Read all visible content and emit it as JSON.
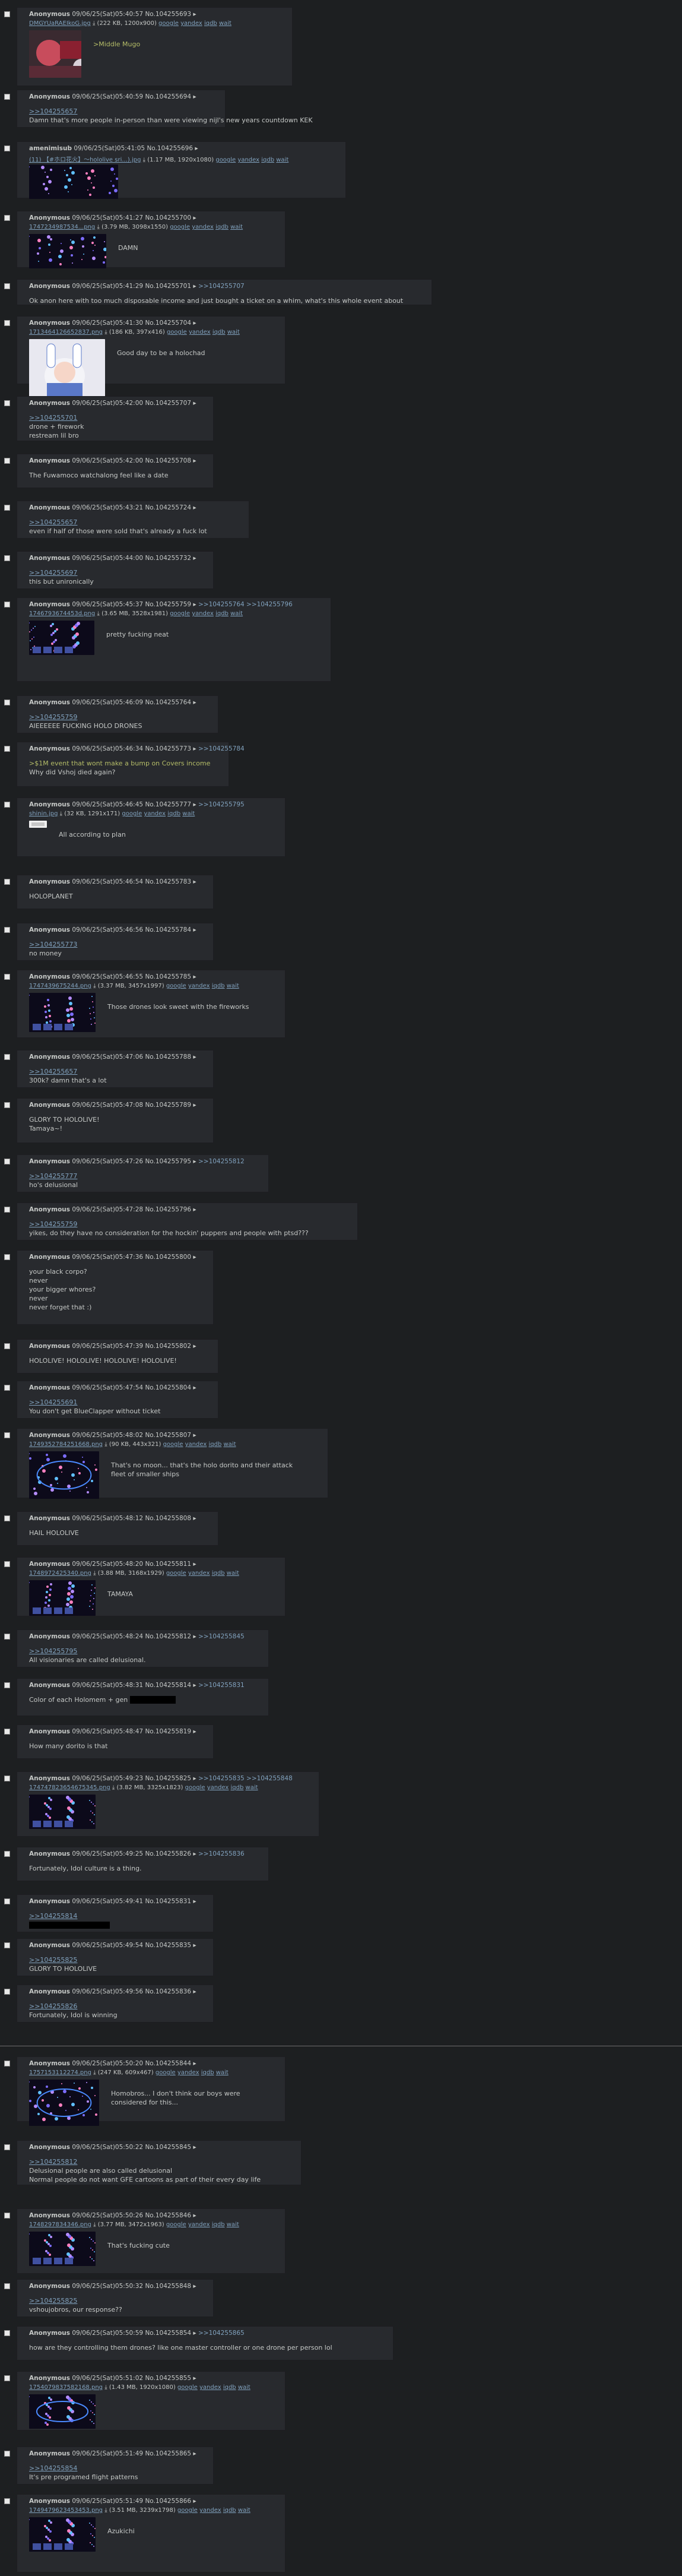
{
  "common": {
    "anon": "Anonymous",
    "arrow": "▸",
    "google": "google",
    "yandex": "yandex",
    "iqdb": "iqdb",
    "wait": "wait",
    "dl": "⤓"
  },
  "posts": [
    {
      "date": "09/06/25(Sat)05:40:57",
      "no": "No.104255693",
      "file": "DMGYUaRAEIkoG.jpg",
      "meta": "(222 KB, 1200x900)",
      "q": "",
      "body": [
        {
          "t": ">Middle Mugo",
          "c": "gt"
        }
      ]
    },
    {
      "date": "09/06/25(Sat)05:40:59",
      "no": "No.104255694",
      "q": "",
      "body": [
        {
          "t": ">>104255657",
          "c": "ql"
        },
        {
          "t": "Damn that's more people in-person than were viewing nijl's new years countdown KEK"
        }
      ]
    },
    {
      "name": "amenimisub",
      "date": "09/06/25(Sat)05:41:05",
      "no": "No.104255696",
      "file": "(11) 【#ホロ花火】～hololive sri...).jpg",
      "meta": "(1.17 MB, 1920x1080)",
      "q": "",
      "body": []
    },
    {
      "date": "09/06/25(Sat)05:41:27",
      "no": "No.104255700",
      "file": "1747234987534...png",
      "meta": "(3.79 MB, 3098x1550)",
      "q": "",
      "body": [
        {
          "t": "DAMN"
        }
      ]
    },
    {
      "date": "09/06/25(Sat)05:41:29",
      "no": "No.104255701",
      "q": ">>104255707",
      "body": [
        {
          "t": "Ok anon here with too much disposable income and just bought a ticket on a whim, what's this whole event about"
        }
      ]
    },
    {
      "date": "09/06/25(Sat)05:41:30",
      "no": "No.104255704",
      "file": "1713464126652837.png",
      "meta": "(186 KB, 397x416)",
      "q": "",
      "body": [
        {
          "t": "Good day to be a holochad"
        }
      ]
    },
    {
      "date": "09/06/25(Sat)05:42:00",
      "no": "No.104255707",
      "q": "",
      "body": [
        {
          "t": ">>104255701",
          "c": "ql"
        },
        {
          "t": "drone + firework"
        },
        {
          "t": "restream lil bro"
        }
      ]
    },
    {
      "date": "09/06/25(Sat)05:42:00",
      "no": "No.104255708",
      "q": "",
      "body": [
        {
          "t": "The Fuwamoco watchalong feel like a date"
        }
      ]
    },
    {
      "date": "09/06/25(Sat)05:43:21",
      "no": "No.104255724",
      "q": "",
      "body": [
        {
          "t": ">>104255657",
          "c": "ql"
        },
        {
          "t": "even if half of those were sold that's already a fuck lot"
        }
      ]
    },
    {
      "date": "09/06/25(Sat)05:44:00",
      "no": "No.104255732",
      "q": "",
      "body": [
        {
          "t": ">>104255697",
          "c": "ql"
        },
        {
          "t": "this but unironically"
        }
      ]
    },
    {
      "date": "09/06/25(Sat)05:45:37",
      "no": "No.104255759",
      "q": ">>104255764 >>104255796",
      "file": "1746793674453d.png",
      "meta": "(3.65 MB, 3528x1981)",
      "body": [
        {
          "t": "pretty fucking neat"
        }
      ]
    },
    {
      "date": "09/06/25(Sat)05:46:09",
      "no": "No.104255764",
      "q": "",
      "body": [
        {
          "t": ">>104255759",
          "c": "ql"
        },
        {
          "t": "AIEEEEEE FUCKING HOLO DRONES"
        }
      ]
    },
    {
      "date": "09/06/25(Sat)05:46:34",
      "no": "No.104255773",
      "q": ">>104255784",
      "body": [
        {
          "t": ">$1M event that wont make a bump on Covers income",
          "c": "gt"
        },
        {
          "t": "Why did Vshoj died again?"
        }
      ]
    },
    {
      "date": "09/06/25(Sat)05:46:45",
      "no": "No.104255777",
      "q": ">>104255795",
      "file": "shinin.jpg",
      "meta": "(32 KB, 1291x171)",
      "body": [
        {
          "t": "All according to plan"
        }
      ]
    },
    {
      "date": "09/06/25(Sat)05:46:54",
      "no": "No.104255783",
      "q": "",
      "body": [
        {
          "t": "HOLOPLANET"
        }
      ]
    },
    {
      "date": "09/06/25(Sat)05:46:56",
      "no": "No.104255784",
      "q": "",
      "body": [
        {
          "t": ">>104255773",
          "c": "ql"
        },
        {
          "t": "no money"
        }
      ]
    },
    {
      "date": "09/06/25(Sat)05:46:55",
      "no": "No.104255785",
      "file": "1747439675244.png",
      "meta": "(3.37 MB, 3457x1997)",
      "q": "",
      "body": [
        {
          "t": "Those drones look sweet with the fireworks"
        }
      ]
    },
    {
      "date": "09/06/25(Sat)05:47:06",
      "no": "No.104255788",
      "q": "",
      "body": [
        {
          "t": ">>104255657",
          "c": "ql"
        },
        {
          "t": "300k? damn that's a lot"
        }
      ]
    },
    {
      "date": "09/06/25(Sat)05:47:08",
      "no": "No.104255789",
      "q": "",
      "body": [
        {
          "t": "GLORY TO HOLOLIVE!"
        },
        {
          "t": "Tamaya~!"
        }
      ]
    },
    {
      "date": "09/06/25(Sat)05:47:26",
      "no": "No.104255795",
      "q": ">>104255812",
      "body": [
        {
          "t": ">>104255777",
          "c": "ql"
        },
        {
          "t": "ho's delusional"
        }
      ]
    },
    {
      "date": "09/06/25(Sat)05:47:28",
      "no": "No.104255796",
      "q": "",
      "body": [
        {
          "t": ">>104255759",
          "c": "ql"
        },
        {
          "t": "yikes, do they have no consideration for the hockin' puppers and people with ptsd???"
        }
      ]
    },
    {
      "date": "09/06/25(Sat)05:47:36",
      "no": "No.104255800",
      "q": "",
      "body": [
        {
          "t": "your black corpo?"
        },
        {
          "t": "never"
        },
        {
          "t": "your bigger whores?"
        },
        {
          "t": "never"
        },
        {
          "t": "never forget that :)"
        }
      ]
    },
    {
      "date": "09/06/25(Sat)05:47:39",
      "no": "No.104255802",
      "q": "",
      "body": [
        {
          "t": "HOLOLIVE! HOLOLIVE! HOLOLIVE! HOLOLIVE!"
        }
      ]
    },
    {
      "date": "09/06/25(Sat)05:47:54",
      "no": "No.104255804",
      "q": "",
      "body": [
        {
          "t": ">>104255691",
          "c": "ql"
        },
        {
          "t": "You don't get BlueClapper without ticket"
        }
      ]
    },
    {
      "date": "09/06/25(Sat)05:48:02",
      "no": "No.104255807",
      "file": "1749352784251668.png",
      "meta": "(90 KB, 443x321)",
      "q": "",
      "body": [
        {
          "t": "That's no moon... that's the holo dorito and their attack"
        },
        {
          "t": "fleet of smaller ships"
        }
      ]
    },
    {
      "date": "09/06/25(Sat)05:48:12",
      "no": "No.104255808",
      "q": "",
      "body": [
        {
          "t": "HAIL HOLOLIVE"
        }
      ]
    },
    {
      "date": "09/06/25(Sat)05:48:20",
      "no": "No.104255811",
      "file": "1748972425340.png",
      "meta": "(3.88 MB, 3168x1929)",
      "q": "",
      "body": [
        {
          "t": "TAMAYA"
        }
      ]
    },
    {
      "date": "09/06/25(Sat)05:48:24",
      "no": "No.104255812",
      "q": ">>104255845",
      "body": [
        {
          "t": ">>104255795",
          "c": "ql"
        },
        {
          "t": "All visionaries are called delusional."
        }
      ]
    },
    {
      "date": "09/06/25(Sat)05:48:31",
      "no": "No.104255814",
      "q": ">>104255831",
      "body": [
        {
          "t": "Color of each Holomem + gen"
        }
      ]
    },
    {
      "date": "09/06/25(Sat)05:48:47",
      "no": "No.104255819",
      "q": "",
      "body": [
        {
          "t": "How many dorito is that"
        }
      ]
    },
    {
      "date": "09/06/25(Sat)05:49:23",
      "no": "No.104255825",
      "q": ">>104255835 >>104255848",
      "file": "174747823654675345.png",
      "meta": "(3.82 MB, 3325x1823)",
      "body": []
    },
    {
      "date": "09/06/25(Sat)05:49:25",
      "no": "No.104255826",
      "q": ">>104255836",
      "body": [
        {
          "t": "Fortunately, Idol culture is a thing."
        }
      ]
    },
    {
      "date": "09/06/25(Sat)05:49:41",
      "no": "No.104255831",
      "q": "",
      "body": [
        {
          "t": ">>104255814",
          "c": "ql"
        }
      ]
    },
    {
      "date": "09/06/25(Sat)05:49:54",
      "no": "No.104255835",
      "q": "",
      "body": [
        {
          "t": ">>104255825",
          "c": "ql"
        },
        {
          "t": "GLORY TO HOLOLIVE"
        }
      ]
    },
    {
      "date": "09/06/25(Sat)05:49:56",
      "no": "No.104255836",
      "q": "",
      "body": [
        {
          "t": ">>104255826",
          "c": "ql"
        },
        {
          "t": "Fortunately, Idol is winning"
        }
      ]
    },
    {
      "date": "09/06/25(Sat)05:50:20",
      "no": "No.104255844",
      "file": "1757153112274.png",
      "meta": "(247 KB, 609x467)",
      "q": "",
      "body": [
        {
          "t": "Homobros... I don't think our boys were"
        },
        {
          "t": "considered for this..."
        }
      ]
    },
    {
      "date": "09/06/25(Sat)05:50:22",
      "no": "No.104255845",
      "q": "",
      "body": [
        {
          "t": ">>104255812",
          "c": "ql"
        },
        {
          "t": "Delusional people are also called delusional"
        },
        {
          "t": "Normal people do not want GFE cartoons as part of their every day life"
        }
      ]
    },
    {
      "date": "09/06/25(Sat)05:50:26",
      "no": "No.104255846",
      "file": "1748297834346.png",
      "meta": "(3.77 MB, 3472x1963)",
      "q": "",
      "body": [
        {
          "t": "That's fucking cute"
        }
      ]
    },
    {
      "date": "09/06/25(Sat)05:50:32",
      "no": "No.104255848",
      "q": "",
      "body": [
        {
          "t": ">>104255825",
          "c": "ql"
        },
        {
          "t": "vshoujobros, our response??"
        }
      ]
    },
    {
      "date": "09/06/25(Sat)05:50:59",
      "no": "No.104255854",
      "q": ">>104255865",
      "body": [
        {
          "t": "how are they controlling them drones? like one master controller or one drone per person lol"
        }
      ]
    },
    {
      "date": "09/06/25(Sat)05:51:02",
      "no": "No.104255855",
      "file": "1754079837582168.png",
      "meta": "(1.43 MB, 1920x1080)",
      "q": "",
      "body": []
    },
    {
      "date": "09/06/25(Sat)05:51:49",
      "no": "No.104255865",
      "q": "",
      "body": [
        {
          "t": ">>104255854",
          "c": "ql"
        },
        {
          "t": "It's pre programed flight patterns"
        }
      ]
    },
    {
      "date": "09/06/25(Sat)05:51:49",
      "no": "No.104255866",
      "file": "1749479623453453.png",
      "meta": "(3.51 MB, 3239x1798)",
      "q": "",
      "body": [
        {
          "t": "Azukichi"
        }
      ]
    }
  ]
}
